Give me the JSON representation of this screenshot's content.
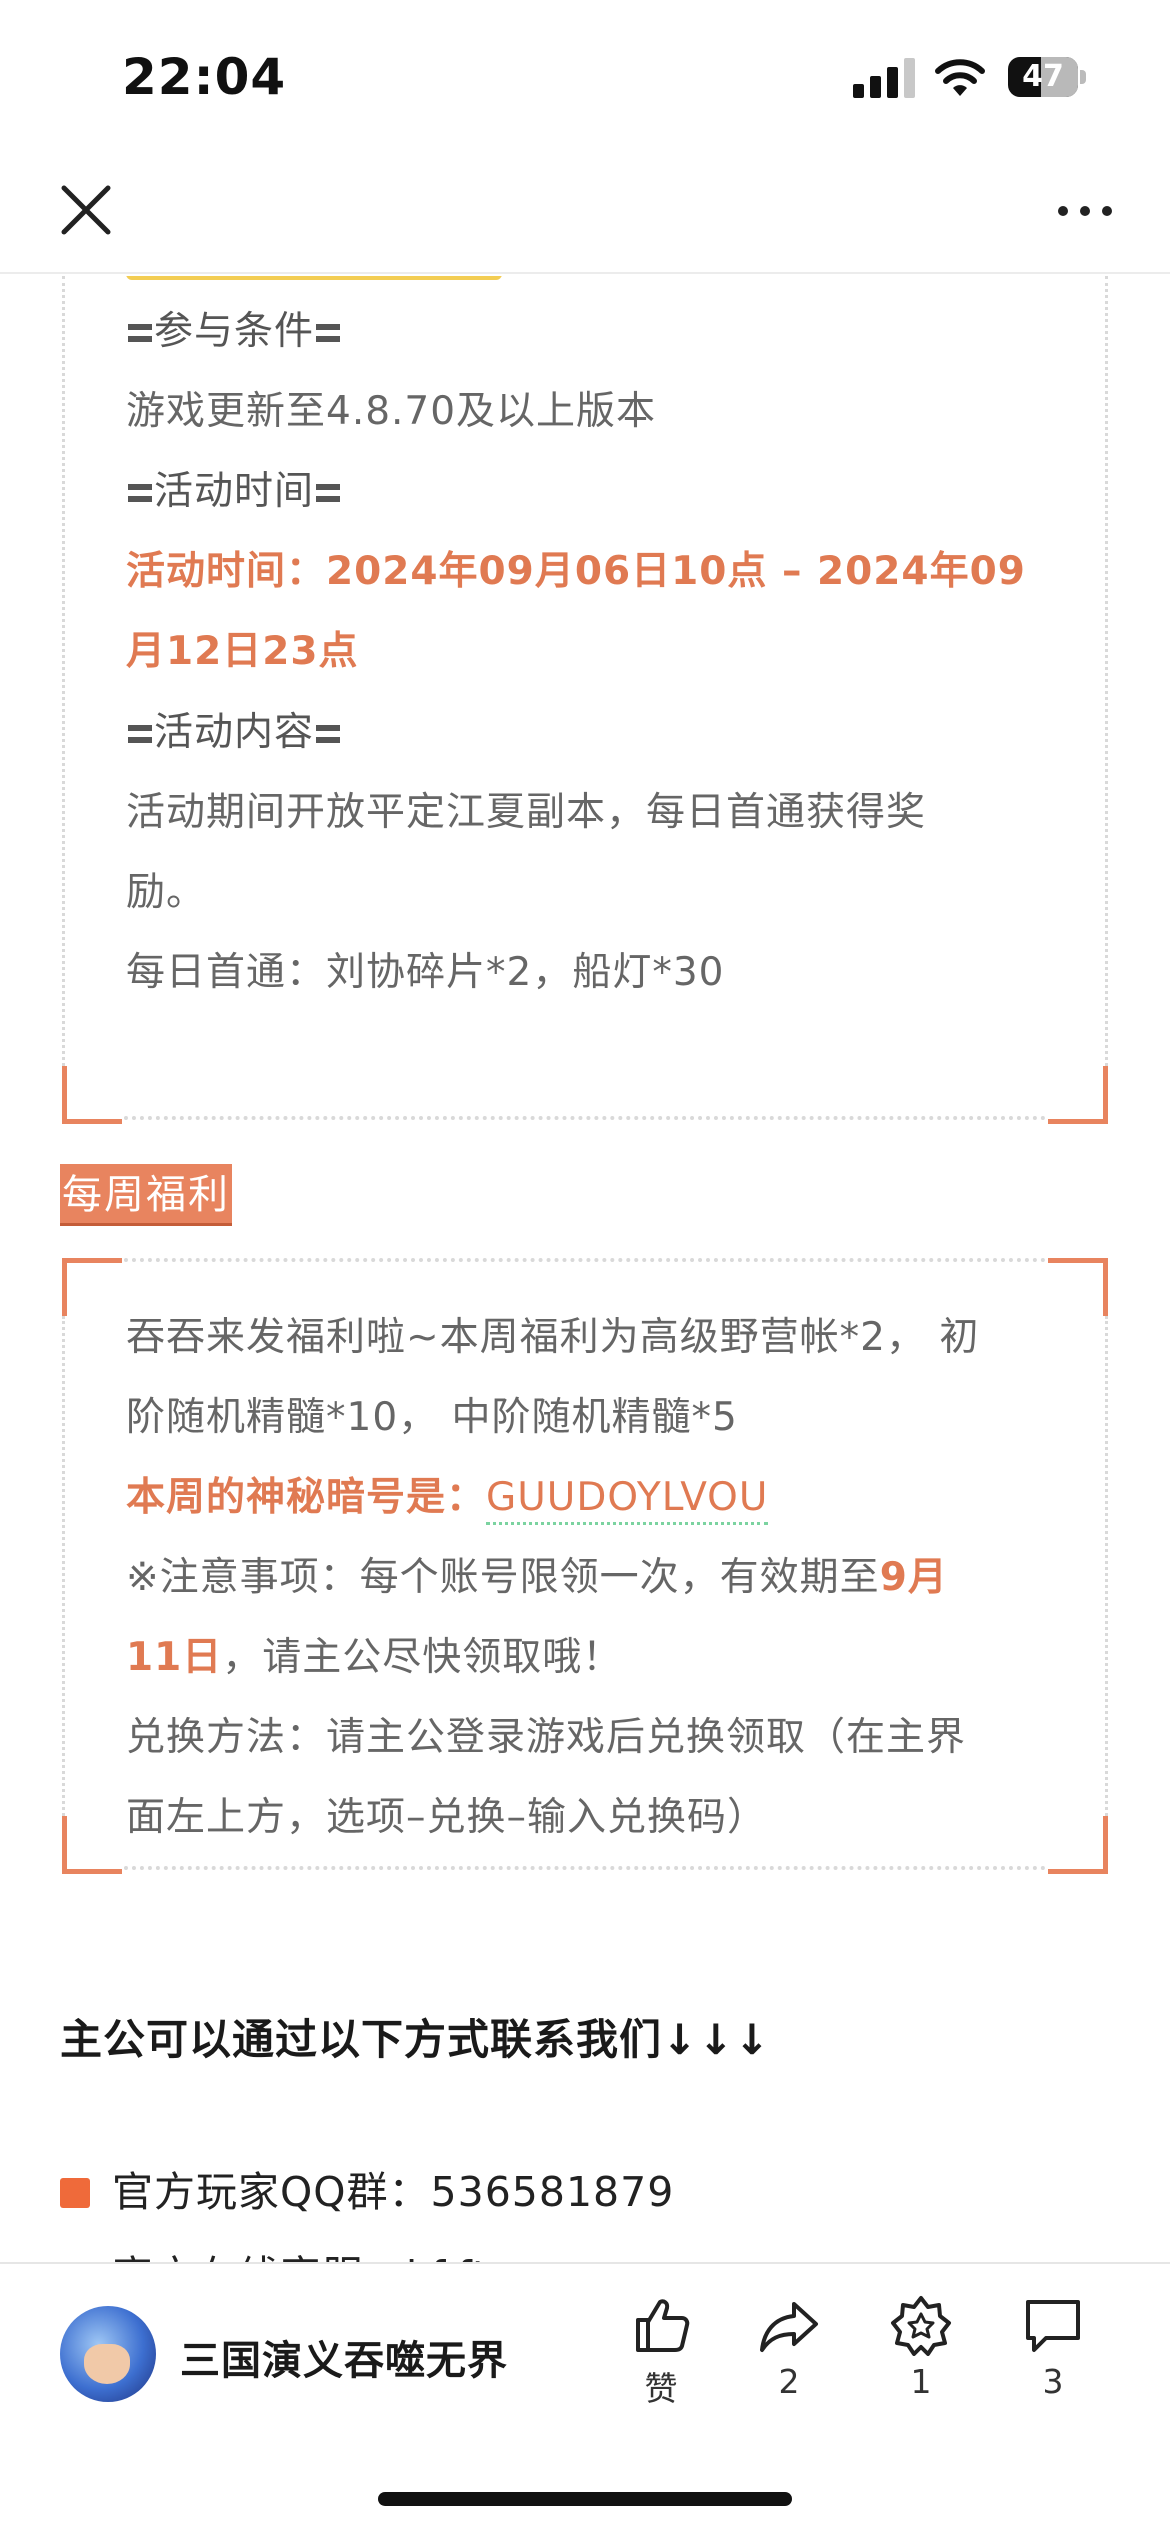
{
  "status_bar": {
    "time": "22:04",
    "battery": "47",
    "battery_level": 0.47
  },
  "nav": {
    "close_icon": "close-icon",
    "more_icon": "more-dots-icon"
  },
  "event": {
    "participation_heading": "参与条件",
    "participation_text": "游戏更新至4.8.70及以上版本",
    "time_heading": "活动时间",
    "time_line1": "活动时间：2024年09月06日10点 – 2024年09",
    "time_line2": "月12日23点",
    "content_heading": "活动内容",
    "content_line1": "活动期间开放平定江夏副本，每日首通获得奖",
    "content_line2": "励。",
    "reward_line": "每日首通：刘协碎片*2，船灯*30"
  },
  "weekly": {
    "title": "每周福利",
    "line1": "吞吞来发福利啦~本周福利为高级野营帐*2，  初",
    "line2": "阶随机精髓*10，  中阶随机精髓*5",
    "code_label": "本周的神秘暗号是：",
    "code_value": "GUUDOYLVOU",
    "notice_prefix": "※注意事项：每个账号限领一次，有效期至",
    "notice_date1": "9月",
    "notice_date2": "11日",
    "notice_suffix": "，请主公尽快领取哦！",
    "redeem_line1": "兑换方法：请主公登录游戏后兑换领取（在主界",
    "redeem_line2": "面左上方，选项–兑换–输入兑换码）"
  },
  "contact": {
    "heading": "主公可以通过以下方式联系我们↓↓↓",
    "items": [
      {
        "label": "官方玩家QQ群：536581879"
      },
      {
        "label": "官方在线客服：kf.ft..."
      }
    ]
  },
  "bottom_bar": {
    "account_name": "三国演义吞噬无界",
    "like_label": "赞",
    "share_count": "2",
    "favorite_count": "1",
    "comment_count": "3"
  },
  "colors": {
    "accent": "#e8845f",
    "highlight_text": "#e07a52",
    "yellow": "#f3cd53",
    "bullet": "#ef6a3a"
  }
}
